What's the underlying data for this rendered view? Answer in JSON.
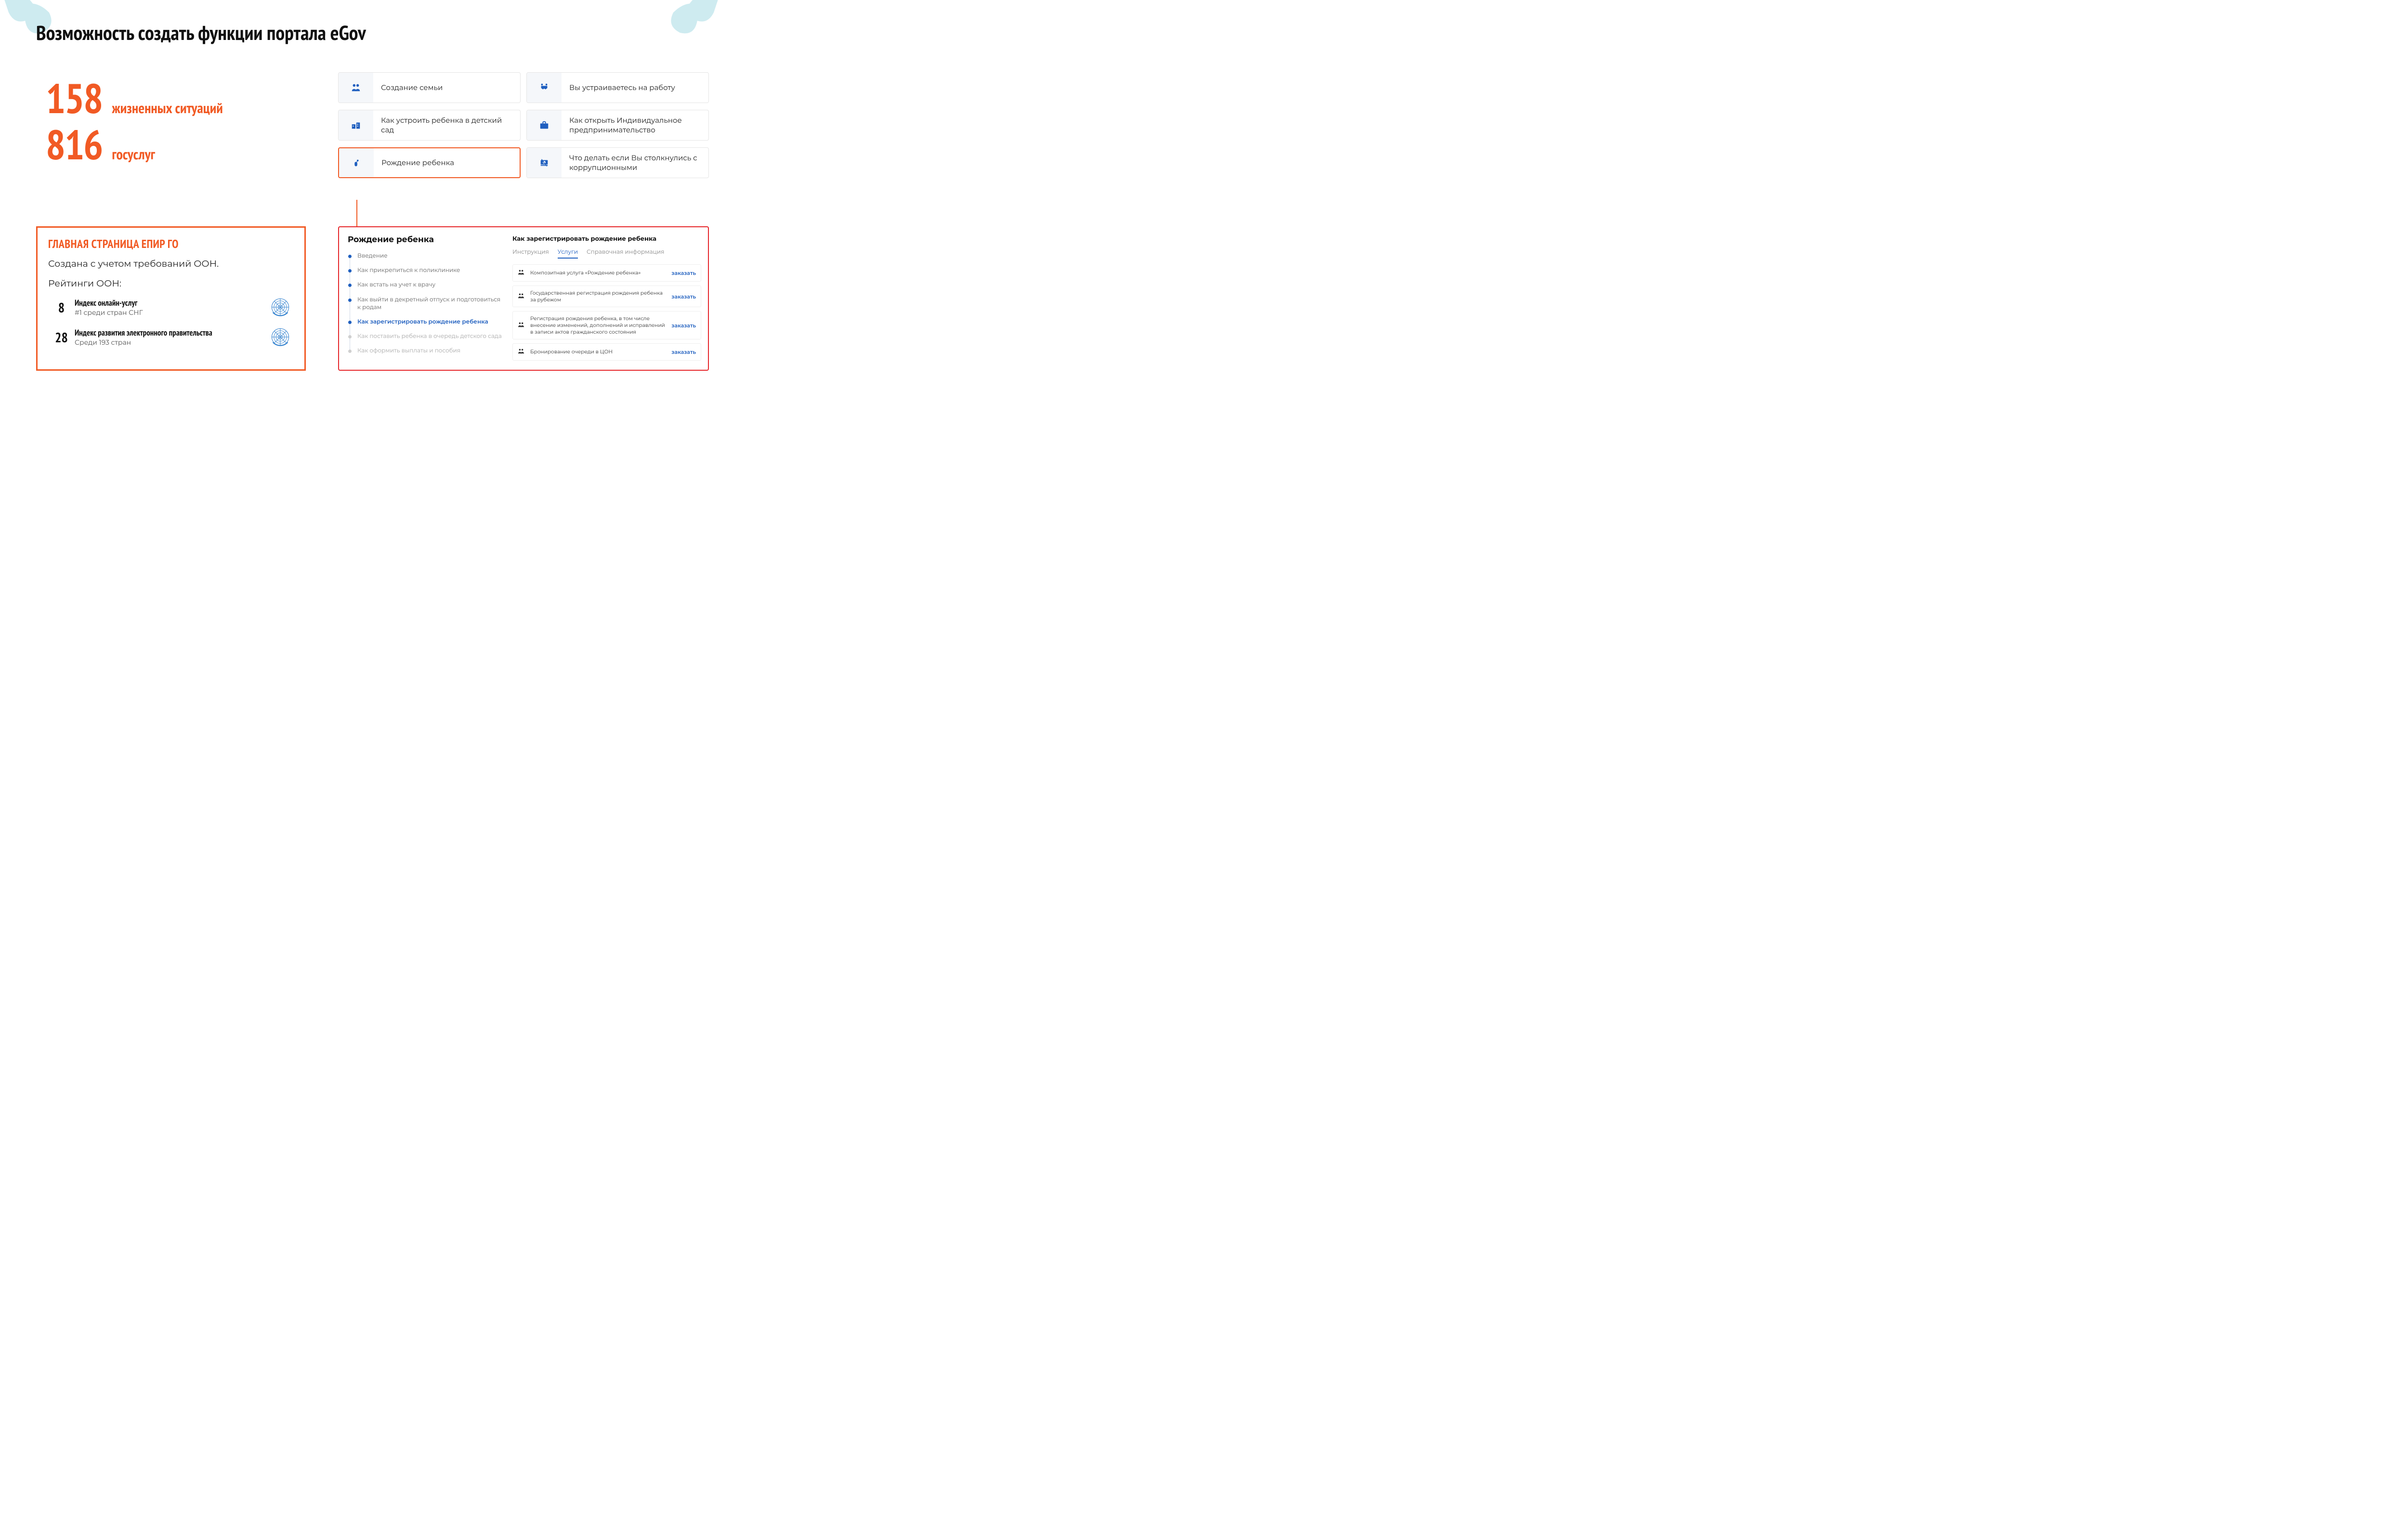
{
  "title": "Возможность создать функции портала eGov",
  "stats": {
    "s1_num": "158",
    "s1_label": "жизненных ситуаций",
    "s2_num": "816",
    "s2_label": "госуслуг"
  },
  "epir": {
    "heading": "ГЛАВНАЯ СТРАНИЦА ЕПИР ГО",
    "subtitle": "Создана с учетом требований ООН.",
    "ranks_label": "Рейтинги ООН:",
    "ranks": [
      {
        "num": "8",
        "title": "Индекс онлайн-услуг",
        "sub": "#1 среди стран СНГ"
      },
      {
        "num": "28",
        "title": "Индекс развития электронного правительства",
        "sub": "Среди 193 стран"
      }
    ]
  },
  "cards": [
    {
      "icon": "family-icon",
      "label": "Создание семьи"
    },
    {
      "icon": "handshake-icon",
      "label": "Вы устраиваетесь на работу"
    },
    {
      "icon": "kindergarten-icon",
      "label": "Как устроить ребенка в детский сад"
    },
    {
      "icon": "briefcase-icon",
      "label": "Как открыть Индивидуальное предпринимательство"
    },
    {
      "icon": "baby-icon",
      "label": "Рождение ребенка",
      "selected": true
    },
    {
      "icon": "anticorruption-icon",
      "label": "Что делать если Вы столкнулись с коррупционными"
    }
  ],
  "detail": {
    "left_title": "Рождение ребенка",
    "steps": [
      {
        "text": "Введение",
        "state": "normal"
      },
      {
        "text": "Как прикрепиться к поликлинике",
        "state": "normal"
      },
      {
        "text": "Как встать на учет к врачу",
        "state": "normal"
      },
      {
        "text": "Как выйти в декретный отпуск и подготовиться к родам",
        "state": "normal"
      },
      {
        "text": "Как зарегистрировать рождение ребенка",
        "state": "active"
      },
      {
        "text": "Как поставить ребенка в очередь детского сада",
        "state": "muted"
      },
      {
        "text": "Как оформить выплаты и пособия",
        "state": "muted"
      }
    ],
    "right_title": "Как зарегистрировать рождение ребенка",
    "tabs": [
      {
        "label": "Инструкция",
        "active": false
      },
      {
        "label": "Услуги",
        "active": true
      },
      {
        "label": "Справочная информация",
        "active": false
      }
    ],
    "services": [
      {
        "text": "Композитная услуга «Рождение ребенка»",
        "action": "заказать"
      },
      {
        "text": "Государственная регистрация рождения ребенка за рубежом",
        "action": "заказать"
      },
      {
        "text": "Регистрация рождения ребенка, в том числе внесение изменений, дополнений и исправлений в записи актов гражданского состояния",
        "action": "заказать"
      },
      {
        "text": "Бронирование очереди в ЦОН",
        "action": "заказать"
      }
    ]
  }
}
